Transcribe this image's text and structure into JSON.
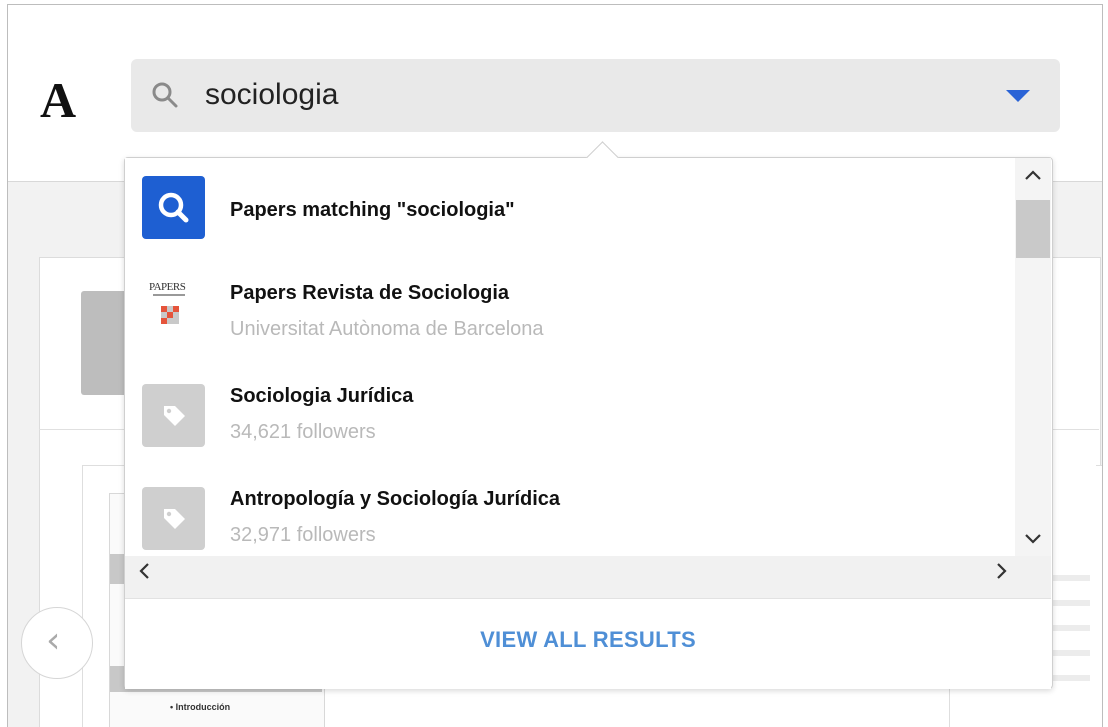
{
  "header": {
    "logo": "A",
    "search_query": "sociologia"
  },
  "background": {
    "doc_intro_text": "• Introducción"
  },
  "dropdown": {
    "results": [
      {
        "type": "search",
        "icon": "search-icon",
        "title": "Papers matching \"sociologia\""
      },
      {
        "type": "journal",
        "icon": "papers-logo",
        "logo_text": "PAPERS",
        "title": "Papers Revista de Sociologia",
        "subtitle": "Universitat Autònoma de Barcelona"
      },
      {
        "type": "tag",
        "icon": "tag-icon",
        "title": "Sociologia Jurídica",
        "subtitle": "34,621 followers"
      },
      {
        "type": "tag",
        "icon": "tag-icon",
        "title": "Antropología y Sociología Jurídica",
        "subtitle": "32,971 followers"
      }
    ],
    "view_all_label": "VIEW ALL RESULTS",
    "scroll_up": "^",
    "scroll_down": "⌄",
    "scroll_left": "‹",
    "scroll_right": "›"
  },
  "colors": {
    "accent": "#1e5fd2",
    "link": "#4f8fd6",
    "muted_text": "#b9b9b9"
  }
}
